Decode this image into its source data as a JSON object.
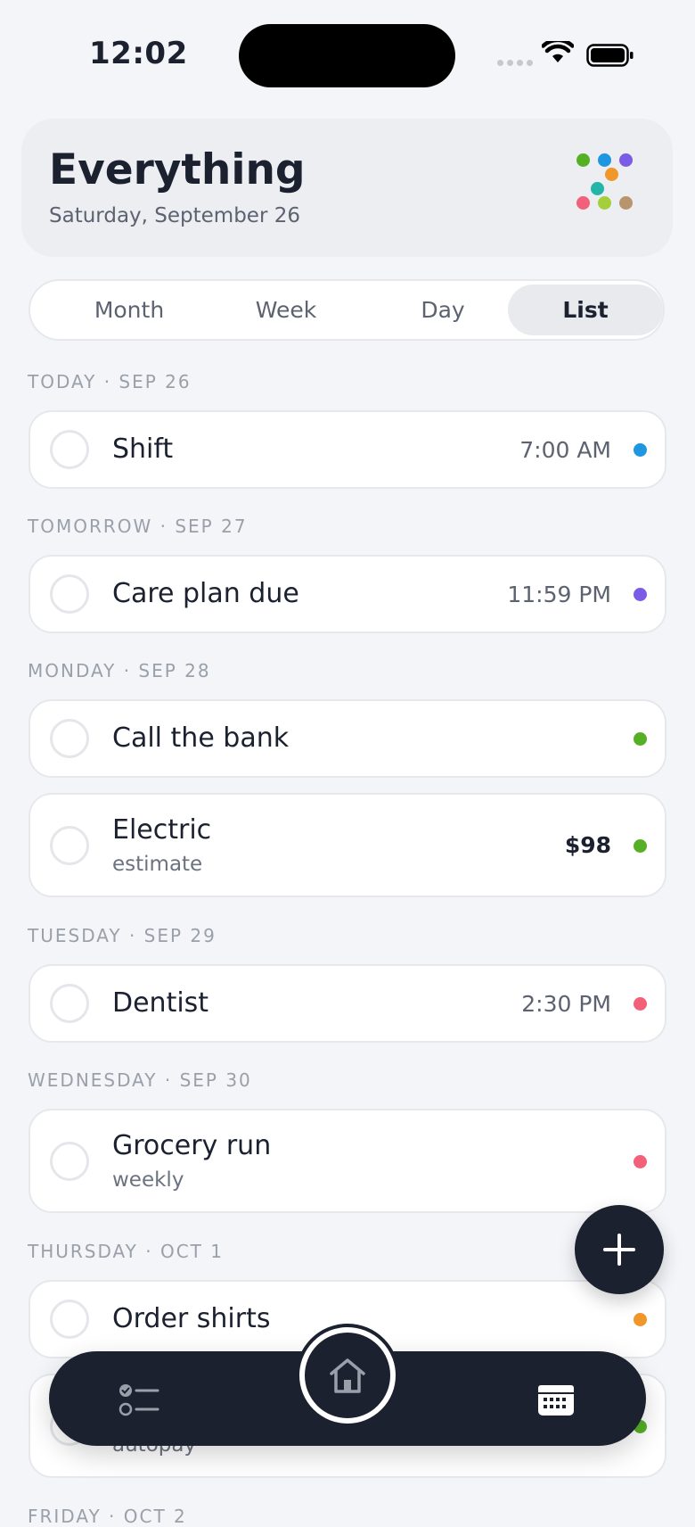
{
  "status": {
    "time": "12:02"
  },
  "header": {
    "title": "Everything",
    "date": "Saturday, September 26"
  },
  "logo_colors": [
    "#56b026",
    "#1e96e0",
    "#7b5ce6",
    "#f0962a",
    "#22b5a8",
    "#f2607a",
    "#a4cf3a",
    "#b8956e"
  ],
  "view_tabs": [
    {
      "label": "Month",
      "active": false
    },
    {
      "label": "Week",
      "active": false
    },
    {
      "label": "Day",
      "active": false
    },
    {
      "label": "List",
      "active": true
    }
  ],
  "sections": [
    {
      "label": "TODAY · SEP 26"
    },
    {
      "label": "TOMORROW · SEP 27"
    },
    {
      "label": "MONDAY · SEP 28"
    },
    {
      "label": "TUESDAY · SEP 29"
    },
    {
      "label": "WEDNESDAY · SEP 30"
    },
    {
      "label": "THURSDAY · OCT 1"
    },
    {
      "label": "FRIDAY · OCT 2"
    }
  ],
  "tasks": [
    {
      "title": "Shift",
      "meta": "7:00 AM",
      "color": "#1e96e0"
    },
    {
      "title": "Care plan due",
      "meta": "11:59 PM",
      "color": "#7b5ce6"
    },
    {
      "title": "Call the bank",
      "color": "#56b026"
    },
    {
      "title": "Electric",
      "subtitle": "estimate",
      "meta": "$98",
      "color": "#56b026"
    },
    {
      "title": "Dentist",
      "meta": "2:30 PM",
      "color": "#f2607a"
    },
    {
      "title": "Grocery run",
      "subtitle": "weekly",
      "color": "#f2607a"
    },
    {
      "title": "Order shirts",
      "color": "#f0962a"
    },
    {
      "title": "",
      "subtitle": "autopay",
      "color": "#56b026"
    }
  ],
  "accent": "#1c2130",
  "icons": {
    "fab": "plus-icon",
    "tab_left": "checklist-icon",
    "tab_center": "home-icon",
    "tab_right": "calendar-icon"
  }
}
